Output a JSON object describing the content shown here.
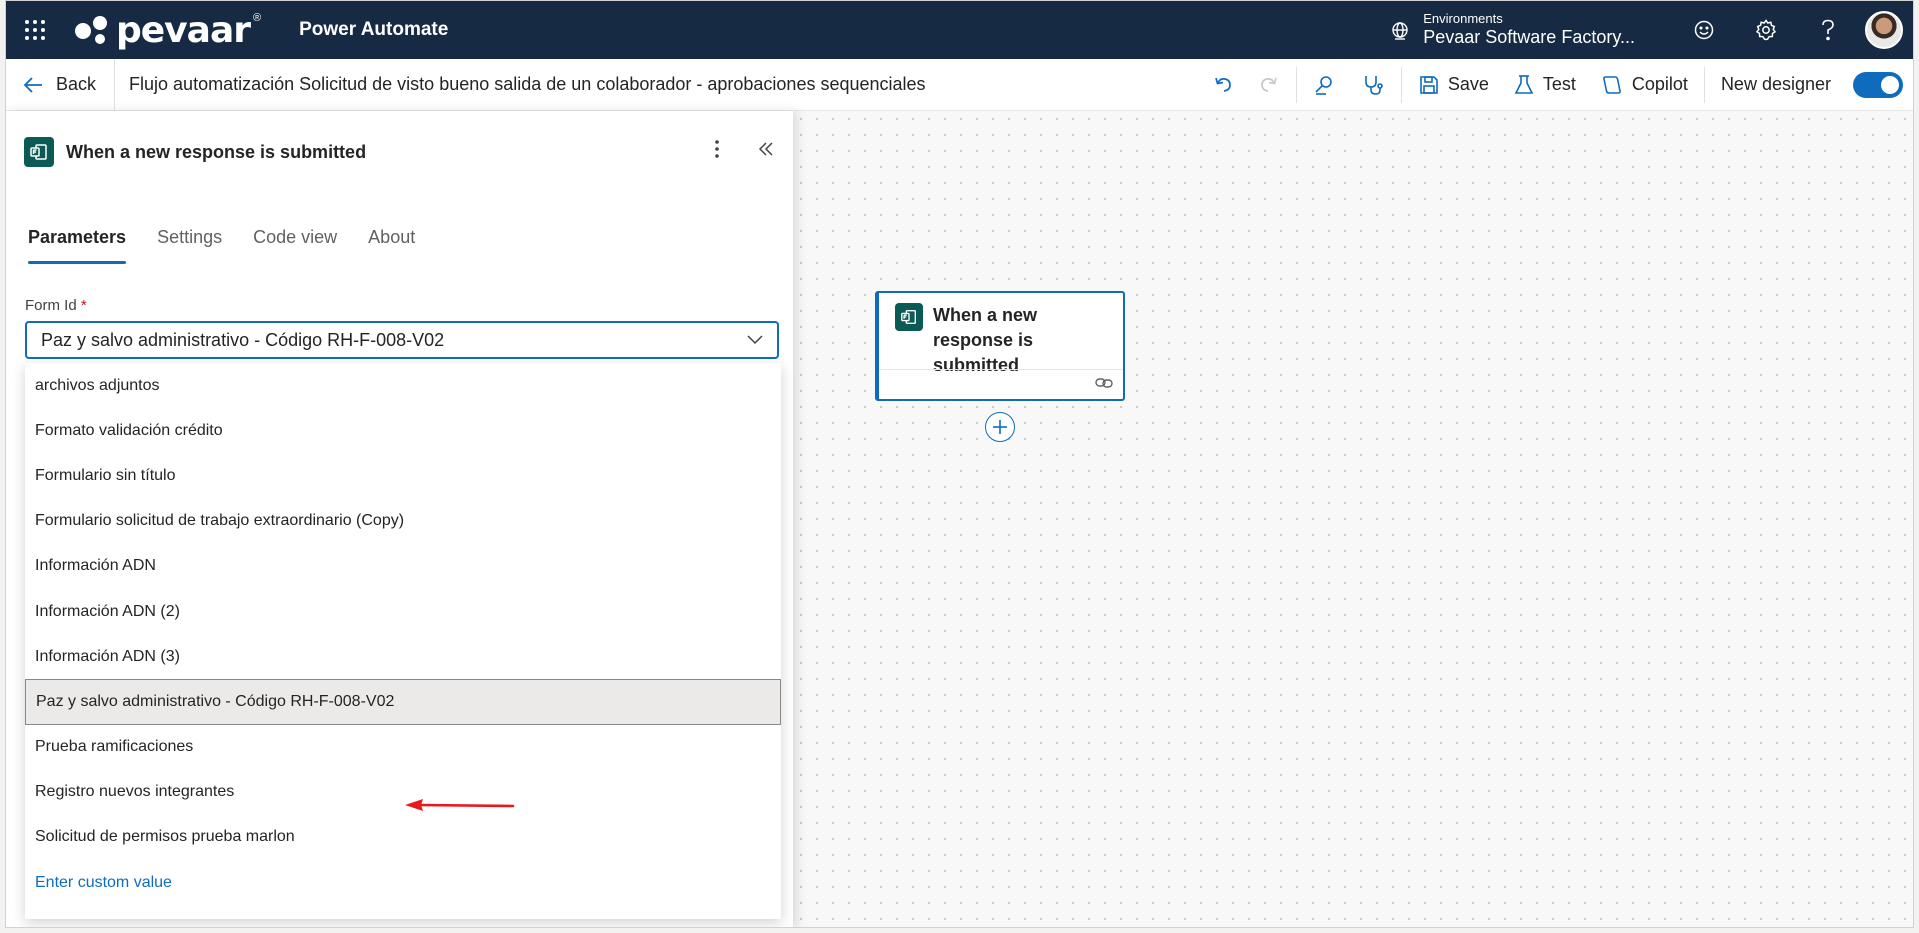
{
  "topbar": {
    "brand": "pevaar",
    "brand_mark": "®",
    "app_name": "Power Automate",
    "environment_label": "Environments",
    "environment_name": "Pevaar Software Factory..."
  },
  "command_bar": {
    "back_label": "Back",
    "flow_title": "Flujo automatización Solicitud de visto bueno salida de un colaborador - aprobaciones sequenciales",
    "save_label": "Save",
    "test_label": "Test",
    "copilot_label": "Copilot",
    "new_designer_label": "New designer",
    "new_designer_on": true
  },
  "panel": {
    "title": "When a new response is submitted",
    "tabs": [
      {
        "label": "Parameters",
        "active": true
      },
      {
        "label": "Settings",
        "active": false
      },
      {
        "label": "Code view",
        "active": false
      },
      {
        "label": "About",
        "active": false
      }
    ],
    "form_id_label": "Form Id",
    "required_mark": "*",
    "form_id_value": "Paz y salvo administrativo - Código RH-F-008-V02",
    "options": [
      "archivos adjuntos",
      "Formato validación crédito",
      "Formulario sin título",
      "Formulario solicitud de trabajo extraordinario (Copy)",
      "Información ADN",
      "Información ADN (2)",
      "Información ADN (3)",
      "Paz y salvo administrativo - Código RH-F-008-V02",
      "Prueba ramificaciones",
      "Registro nuevos integrantes",
      "Solicitud de permisos prueba marlon"
    ],
    "selected_option_index": 7,
    "custom_value_label": "Enter custom value"
  },
  "canvas": {
    "node_title": "When a new response is submitted"
  },
  "colors": {
    "topbar": "#172a43",
    "accent": "#0f6cbd",
    "forms_icon": "#0b5a55",
    "annotation_arrow": "#e8191c"
  }
}
